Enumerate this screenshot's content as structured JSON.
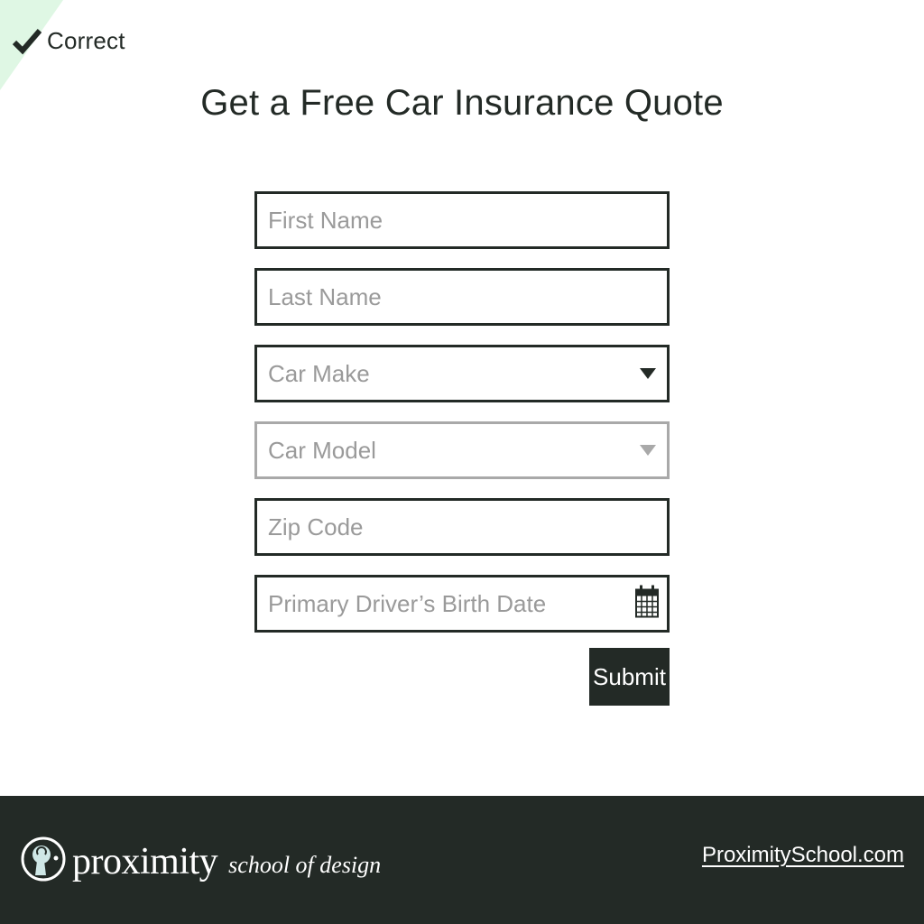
{
  "status": {
    "label": "Correct",
    "icon": "checkmark-icon",
    "corner_color": "#dff7e4"
  },
  "page": {
    "title": "Get a Free Car Insurance Quote"
  },
  "form": {
    "fields": [
      {
        "placeholder": "First Name",
        "type": "text"
      },
      {
        "placeholder": "Last Name",
        "type": "text"
      },
      {
        "placeholder": "Car Make",
        "type": "select",
        "icon": "chevron-down-icon"
      },
      {
        "placeholder": "Car Model",
        "type": "select",
        "icon": "chevron-down-icon",
        "disabled": true
      },
      {
        "placeholder": "Zip Code",
        "type": "text"
      },
      {
        "placeholder": "Primary Driver’s Birth Date",
        "type": "date",
        "icon": "calendar-icon"
      }
    ],
    "submit_label": "Submit"
  },
  "footer": {
    "brand_name": "proximity",
    "brand_sub": "school of design",
    "link_text": "ProximitySchool.com",
    "background": "#232a26"
  },
  "colors": {
    "text": "#232a26",
    "placeholder": "#9a9a9a",
    "disabled_border": "#a9a9a9"
  }
}
